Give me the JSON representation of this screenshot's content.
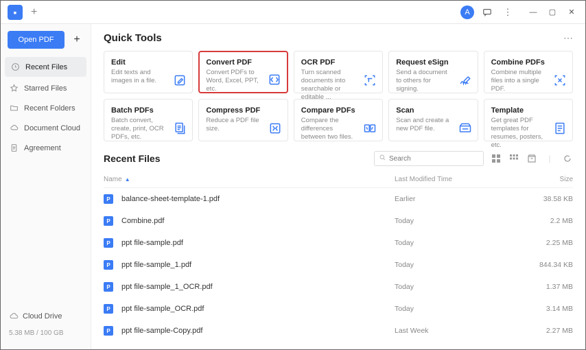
{
  "titlebar": {
    "avatar_letter": "A"
  },
  "sidebar": {
    "open_label": "Open PDF",
    "items": [
      {
        "label": "Recent Files",
        "icon": "clock",
        "active": true
      },
      {
        "label": "Starred Files",
        "icon": "star",
        "active": false
      },
      {
        "label": "Recent Folders",
        "icon": "folder",
        "active": false
      },
      {
        "label": "Document Cloud",
        "icon": "cloud",
        "active": false
      },
      {
        "label": "Agreement",
        "icon": "doc",
        "active": false
      }
    ],
    "cloud_label": "Cloud Drive",
    "storage": "5.38 MB / 100 GB"
  },
  "quicktools": {
    "title": "Quick Tools",
    "cards": [
      {
        "name": "Edit",
        "desc": "Edit texts and images in a file.",
        "icon": "edit"
      },
      {
        "name": "Convert PDF",
        "desc": "Convert PDFs to Word, Excel, PPT, etc.",
        "icon": "convert",
        "selected": true
      },
      {
        "name": "OCR PDF",
        "desc": "Turn scanned documents into searchable or editable ...",
        "icon": "ocr"
      },
      {
        "name": "Request eSign",
        "desc": "Send a document to others for signing.",
        "icon": "esign"
      },
      {
        "name": "Combine PDFs",
        "desc": "Combine multiple files into a single PDF.",
        "icon": "combine"
      },
      {
        "name": "Batch PDFs",
        "desc": "Batch convert, create, print, OCR PDFs, etc.",
        "icon": "batch"
      },
      {
        "name": "Compress PDF",
        "desc": "Reduce a PDF file size.",
        "icon": "compress"
      },
      {
        "name": "Compare PDFs",
        "desc": "Compare the differences between two files.",
        "icon": "compare"
      },
      {
        "name": "Scan",
        "desc": "Scan and create a new PDF file.",
        "icon": "scan"
      },
      {
        "name": "Template",
        "desc": "Get great PDF templates for resumes, posters, etc.",
        "icon": "template"
      }
    ]
  },
  "recentfiles": {
    "title": "Recent Files",
    "search_placeholder": "Search",
    "columns": {
      "name": "Name",
      "modified": "Last Modified Time",
      "size": "Size"
    },
    "rows": [
      {
        "name": "balance-sheet-template-1.pdf",
        "modified": "Earlier",
        "size": "38.58 KB"
      },
      {
        "name": "Combine.pdf",
        "modified": "Today",
        "size": "2.2 MB"
      },
      {
        "name": "ppt file-sample.pdf",
        "modified": "Today",
        "size": "2.25 MB"
      },
      {
        "name": "ppt file-sample_1.pdf",
        "modified": "Today",
        "size": "844.34 KB"
      },
      {
        "name": "ppt file-sample_1_OCR.pdf",
        "modified": "Today",
        "size": "1.37 MB"
      },
      {
        "name": "ppt file-sample_OCR.pdf",
        "modified": "Today",
        "size": "3.14 MB"
      },
      {
        "name": "ppt file-sample-Copy.pdf",
        "modified": "Last Week",
        "size": "2.27 MB"
      }
    ]
  }
}
